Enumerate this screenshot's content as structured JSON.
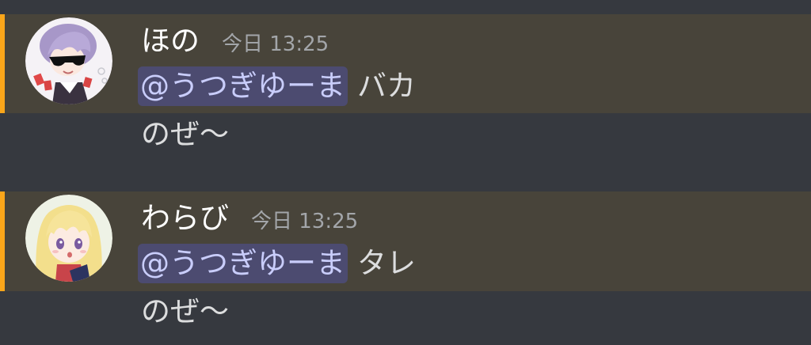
{
  "colors": {
    "background": "#36393f",
    "mention_highlight_bg": "#48443a",
    "mention_accent": "#faa61a",
    "mention_pill_bg": "#4c4b70",
    "mention_pill_text": "#c9cdfb",
    "username": "#ffffff",
    "timestamp": "#a3a6aa",
    "message_text": "#dcddde"
  },
  "messages": [
    {
      "author": "ほの",
      "timestamp": "今日 13:25",
      "avatar_icon": "avatar-purple-hair-sunglasses",
      "mention": "@うつぎゆーま",
      "text": "バカ",
      "followup": "のぜ〜"
    },
    {
      "author": "わらび",
      "timestamp": "今日 13:25",
      "avatar_icon": "avatar-blonde-girl",
      "mention": "@うつぎゆーま",
      "text": "タレ",
      "followup": "のぜ〜"
    }
  ]
}
